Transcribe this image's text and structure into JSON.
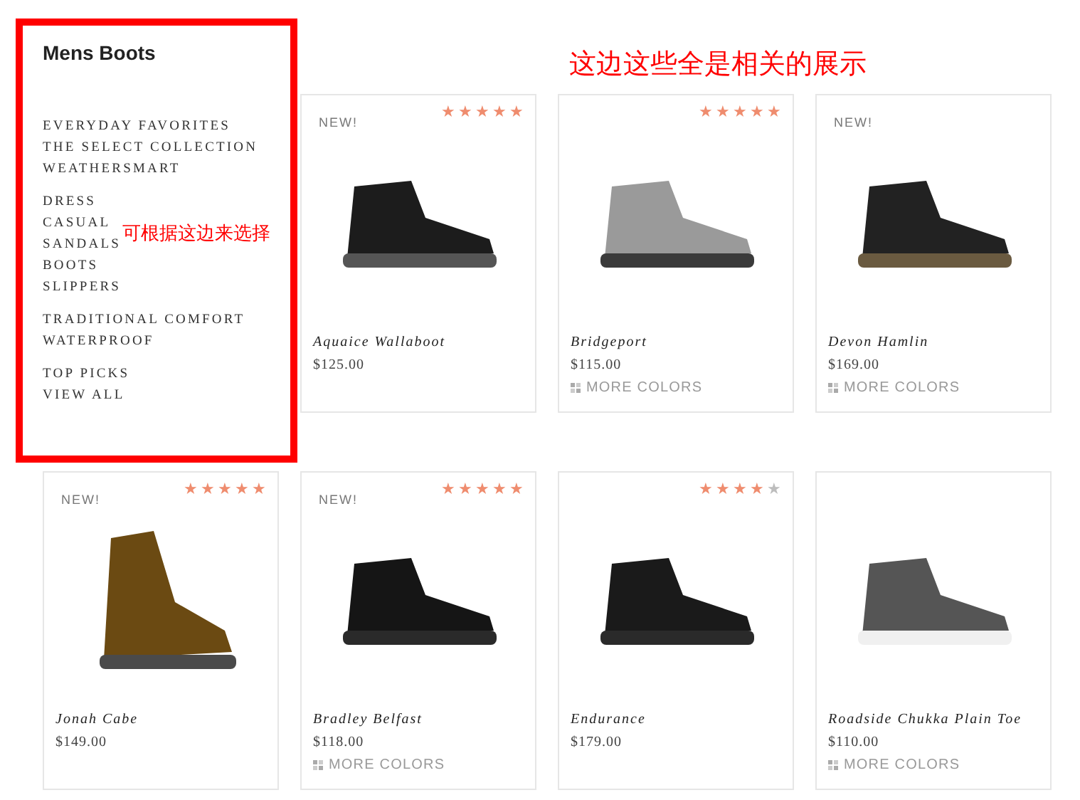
{
  "sidebar": {
    "title": "Mens Boots",
    "groups": [
      {
        "items": [
          "EVERYDAY FAVORITES",
          "THE SELECT COLLECTION",
          "WEATHERSMART"
        ]
      },
      {
        "items": [
          "DRESS",
          "CASUAL",
          "SANDALS",
          "BOOTS",
          "SLIPPERS"
        ]
      },
      {
        "items": [
          "TRADITIONAL COMFORT",
          "WATERPROOF"
        ]
      },
      {
        "items": [
          "TOP PICKS",
          "VIEW ALL"
        ]
      }
    ]
  },
  "products": [
    {
      "badge": "NEW!",
      "stars": 5,
      "name": "Aquaice Wallaboot",
      "price": "$125.00"
    },
    {
      "stars": 5,
      "name": "Bridgeport",
      "price": "$115.00",
      "more_colors": "MORE COLORS"
    },
    {
      "badge": "NEW!",
      "name": "Devon Hamlin",
      "price": "$169.00",
      "more_colors": "MORE COLORS"
    },
    {
      "badge": "NEW!",
      "stars": 5,
      "name": "Jonah Cabe",
      "price": "$149.00"
    },
    {
      "badge": "NEW!",
      "stars": 5,
      "name": "Bradley Belfast",
      "price": "$118.00",
      "more_colors": "MORE COLORS"
    },
    {
      "stars": 4,
      "name": "Endurance",
      "price": "$179.00"
    },
    {
      "name": "Roadside Chukka Plain Toe",
      "price": "$110.00",
      "more_colors": "MORE COLORS"
    }
  ],
  "annotations": [
    "可根据这边来选择",
    "这边这些全是相关的展示"
  ]
}
